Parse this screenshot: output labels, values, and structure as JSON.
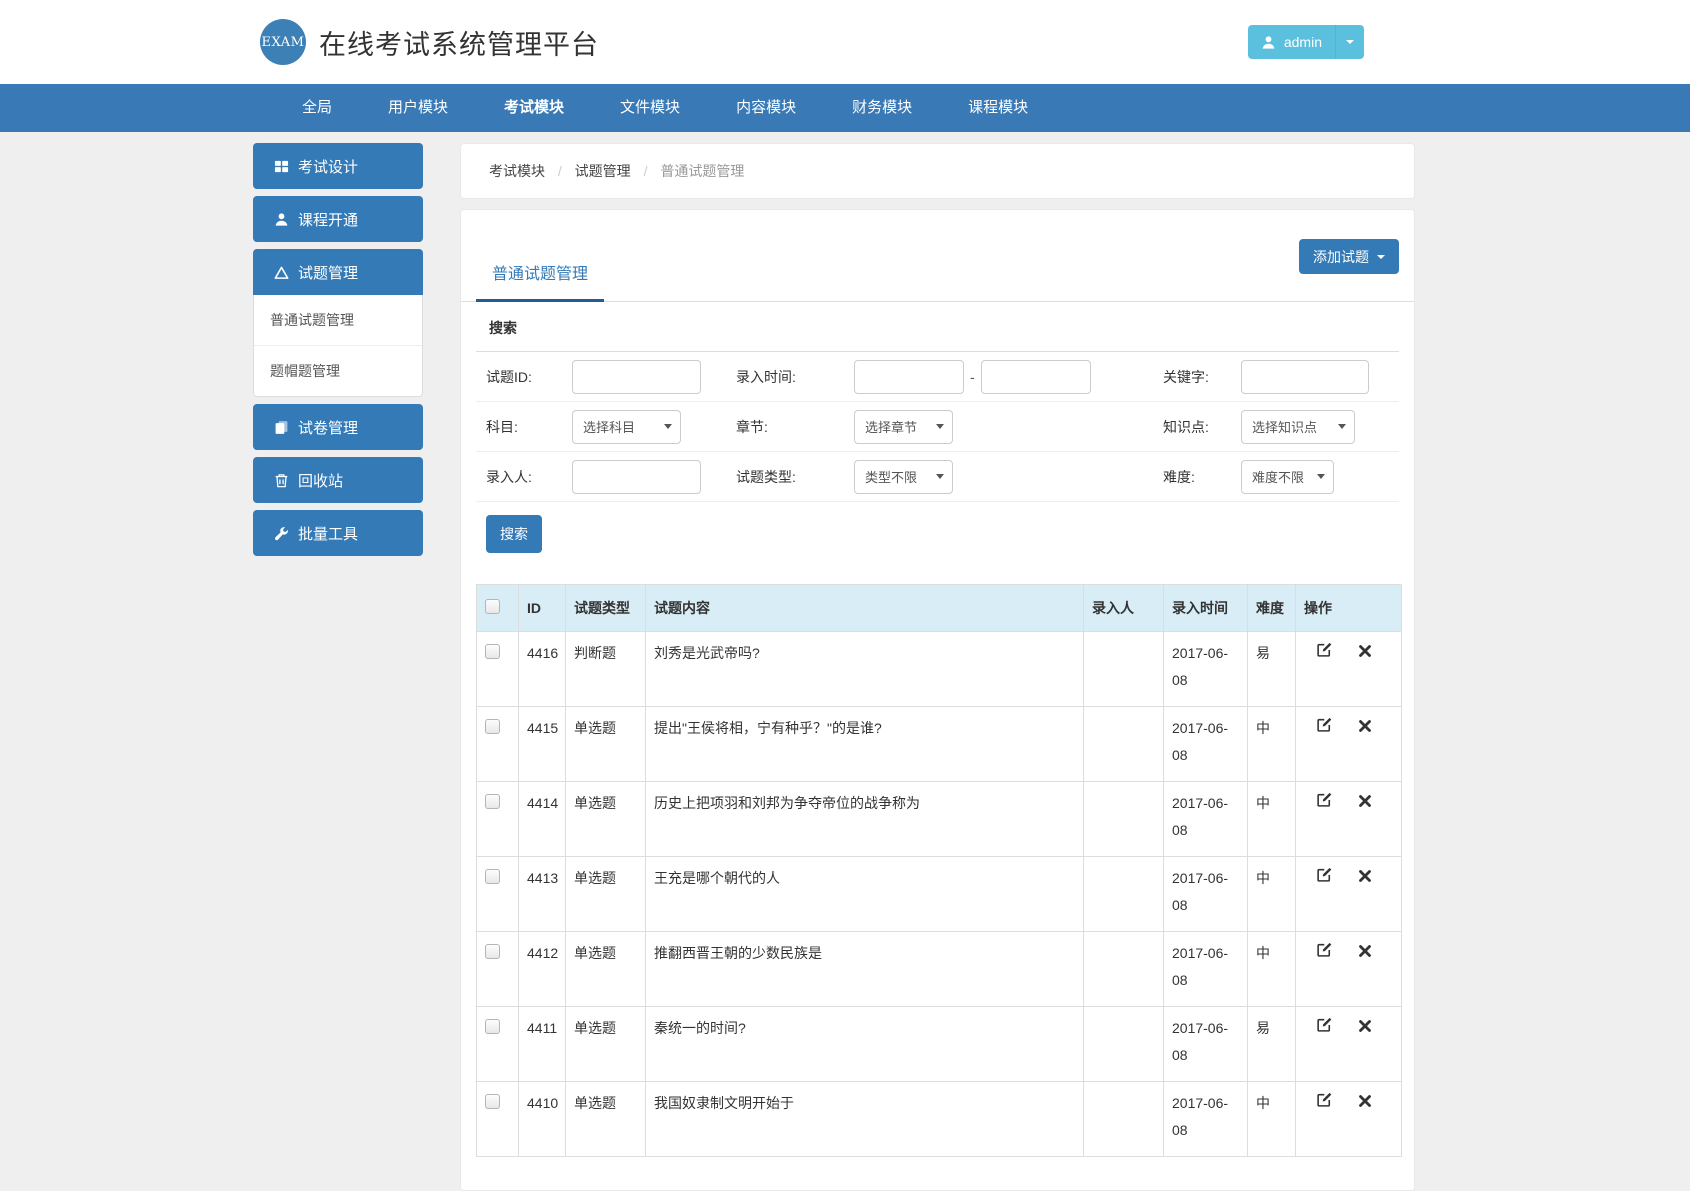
{
  "colors": {
    "primary": "#337ab7",
    "navbar": "#3879b6",
    "user_button": "#5bc0de",
    "table_header_bg": "#d9edf7",
    "tab_underline": "#1f5d94"
  },
  "header": {
    "logo_text": "EXAM",
    "title": "在线考试系统管理平台",
    "user": {
      "name": "admin"
    }
  },
  "navbar": {
    "items": [
      {
        "label": "全局"
      },
      {
        "label": "用户模块"
      },
      {
        "label": "考试模块",
        "active": true
      },
      {
        "label": "文件模块"
      },
      {
        "label": "内容模块"
      },
      {
        "label": "财务模块"
      },
      {
        "label": "课程模块"
      }
    ]
  },
  "sidebar": {
    "items": [
      {
        "label": "考试设计",
        "icon": "grid-icon"
      },
      {
        "label": "课程开通",
        "icon": "user-icon"
      },
      {
        "label": "试题管理",
        "icon": "triangle-icon",
        "children": [
          {
            "label": "普通试题管理"
          },
          {
            "label": "题帽题管理"
          }
        ]
      },
      {
        "label": "试卷管理",
        "icon": "copy-icon"
      },
      {
        "label": "回收站",
        "icon": "trash-icon"
      },
      {
        "label": "批量工具",
        "icon": "wrench-icon"
      }
    ]
  },
  "breadcrumb": {
    "items": [
      "考试模块",
      "试题管理",
      "普通试题管理"
    ]
  },
  "main": {
    "tab": "普通试题管理",
    "add_button": "添加试题",
    "search": {
      "heading": "搜索",
      "fields": {
        "question_id_label": "试题ID:",
        "entry_time_label": "录入时间:",
        "range_separator": "-",
        "keyword_label": "关键字:",
        "subject_label": "科目:",
        "subject_value": "选择科目",
        "chapter_label": "章节:",
        "chapter_value": "选择章节",
        "knowledge_label": "知识点:",
        "knowledge_value": "选择知识点",
        "creator_label": "录入人:",
        "type_label": "试题类型:",
        "type_value": "类型不限",
        "difficulty_label": "难度:",
        "difficulty_value": "难度不限"
      },
      "submit_label": "搜索"
    },
    "table": {
      "headers": [
        "ID",
        "试题类型",
        "试题内容",
        "录入人",
        "录入时间",
        "难度",
        "操作"
      ],
      "rows": [
        {
          "id": "4416",
          "type": "判断题",
          "content": "刘秀是光武帝吗?",
          "creator": "",
          "date": "2017-06-08",
          "difficulty": "易"
        },
        {
          "id": "4415",
          "type": "单选题",
          "content": "提出\"王侯将相，宁有种乎？\"的是谁?",
          "creator": "",
          "date": "2017-06-08",
          "difficulty": "中"
        },
        {
          "id": "4414",
          "type": "单选题",
          "content": "历史上把项羽和刘邦为争夺帝位的战争称为",
          "creator": "",
          "date": "2017-06-08",
          "difficulty": "中"
        },
        {
          "id": "4413",
          "type": "单选题",
          "content": "王充是哪个朝代的人",
          "creator": "",
          "date": "2017-06-08",
          "difficulty": "中"
        },
        {
          "id": "4412",
          "type": "单选题",
          "content": "推翻西晋王朝的少数民族是",
          "creator": "",
          "date": "2017-06-08",
          "difficulty": "中"
        },
        {
          "id": "4411",
          "type": "单选题",
          "content": "秦统一的时间?",
          "creator": "",
          "date": "2017-06-08",
          "difficulty": "易"
        },
        {
          "id": "4410",
          "type": "单选题",
          "content": "我国奴隶制文明开始于",
          "creator": "",
          "date": "2017-06-08",
          "difficulty": "中"
        }
      ]
    }
  }
}
